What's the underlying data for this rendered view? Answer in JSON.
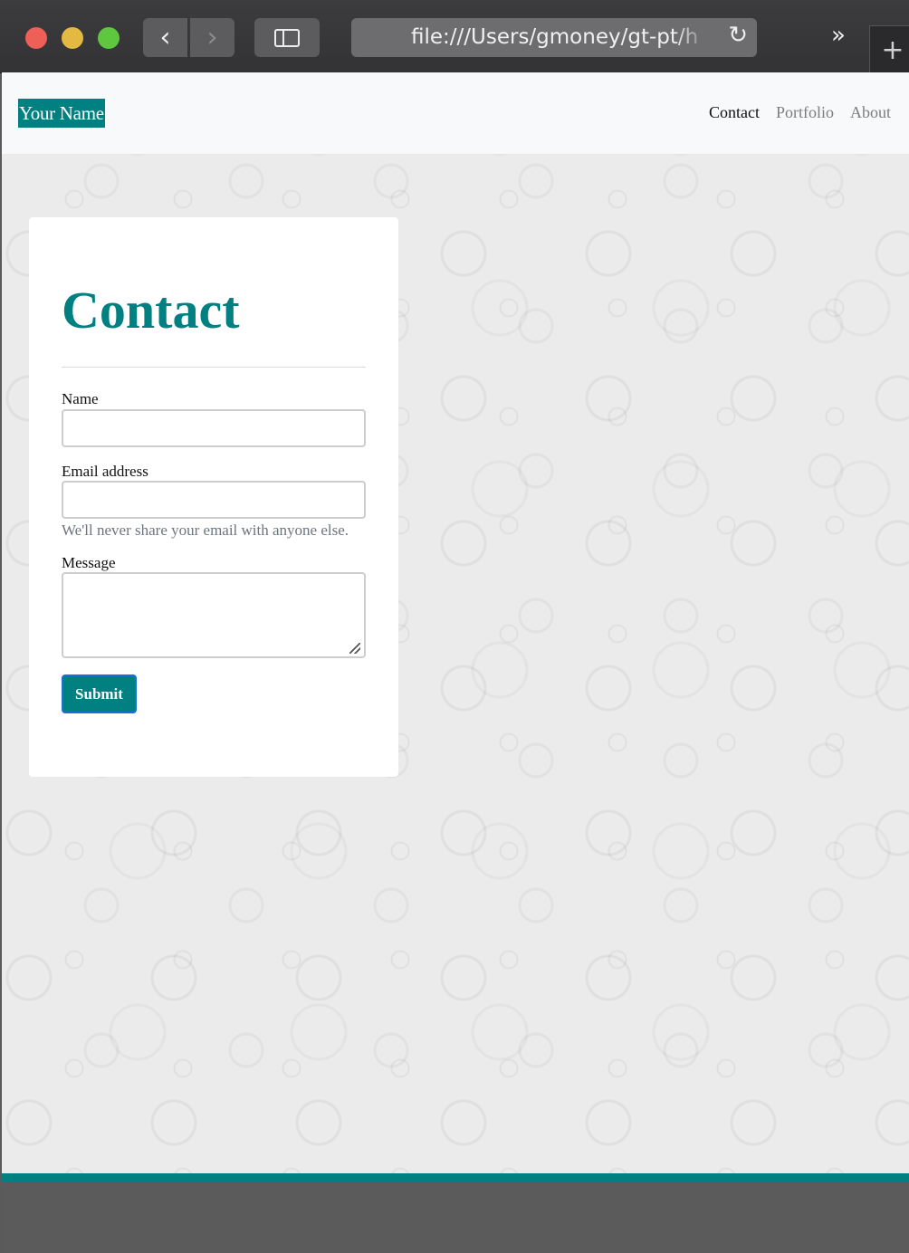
{
  "browser": {
    "url": "file:///Users/gmoney/gt-pt/h",
    "back_glyph": "‹",
    "forward_glyph": "›",
    "reload_glyph": "↻",
    "more_glyph": "»",
    "new_tab_glyph": "+"
  },
  "navbar": {
    "brand": "Your Name",
    "links": [
      {
        "label": "Contact",
        "active": true
      },
      {
        "label": "Portfolio",
        "active": false
      },
      {
        "label": "About",
        "active": false
      }
    ]
  },
  "contact_form": {
    "title": "Contact",
    "name_label": "Name",
    "name_value": "",
    "email_label": "Email address",
    "email_value": "",
    "email_hint": "We'll never share your email with anyone else.",
    "message_label": "Message",
    "message_value": "",
    "submit_label": "Submit"
  },
  "colors": {
    "accent": "#008080",
    "navbar_bg": "#f8f9fa",
    "page_bg": "#ebebeb",
    "muted_text": "#6c757d"
  }
}
